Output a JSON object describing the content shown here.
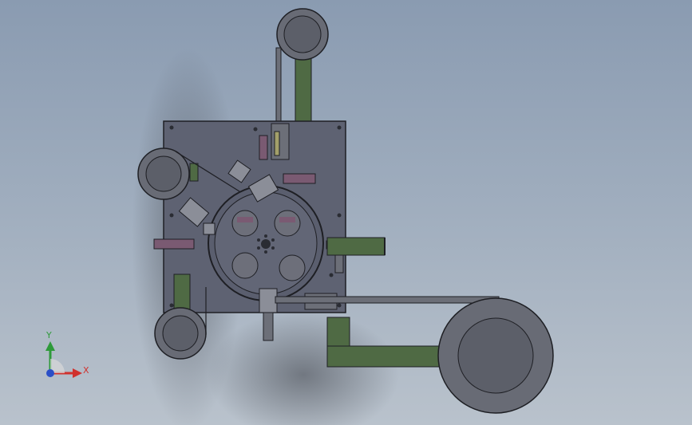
{
  "colors": {
    "background_top": "#8a9bb1",
    "background_bottom": "#b9c2cc",
    "plate": "#5e6272",
    "reel": "#686b75",
    "reel_hub": "#5c5f69",
    "conveyor_green": "#4f6a44",
    "part_magenta": "#7a5a72",
    "outline": "#1e1f24",
    "axis_x": "#d0312d",
    "axis_y": "#2e9a3a",
    "axis_z": "#2b4fc7"
  },
  "triad": {
    "x_label": "X",
    "y_label": "Y"
  }
}
